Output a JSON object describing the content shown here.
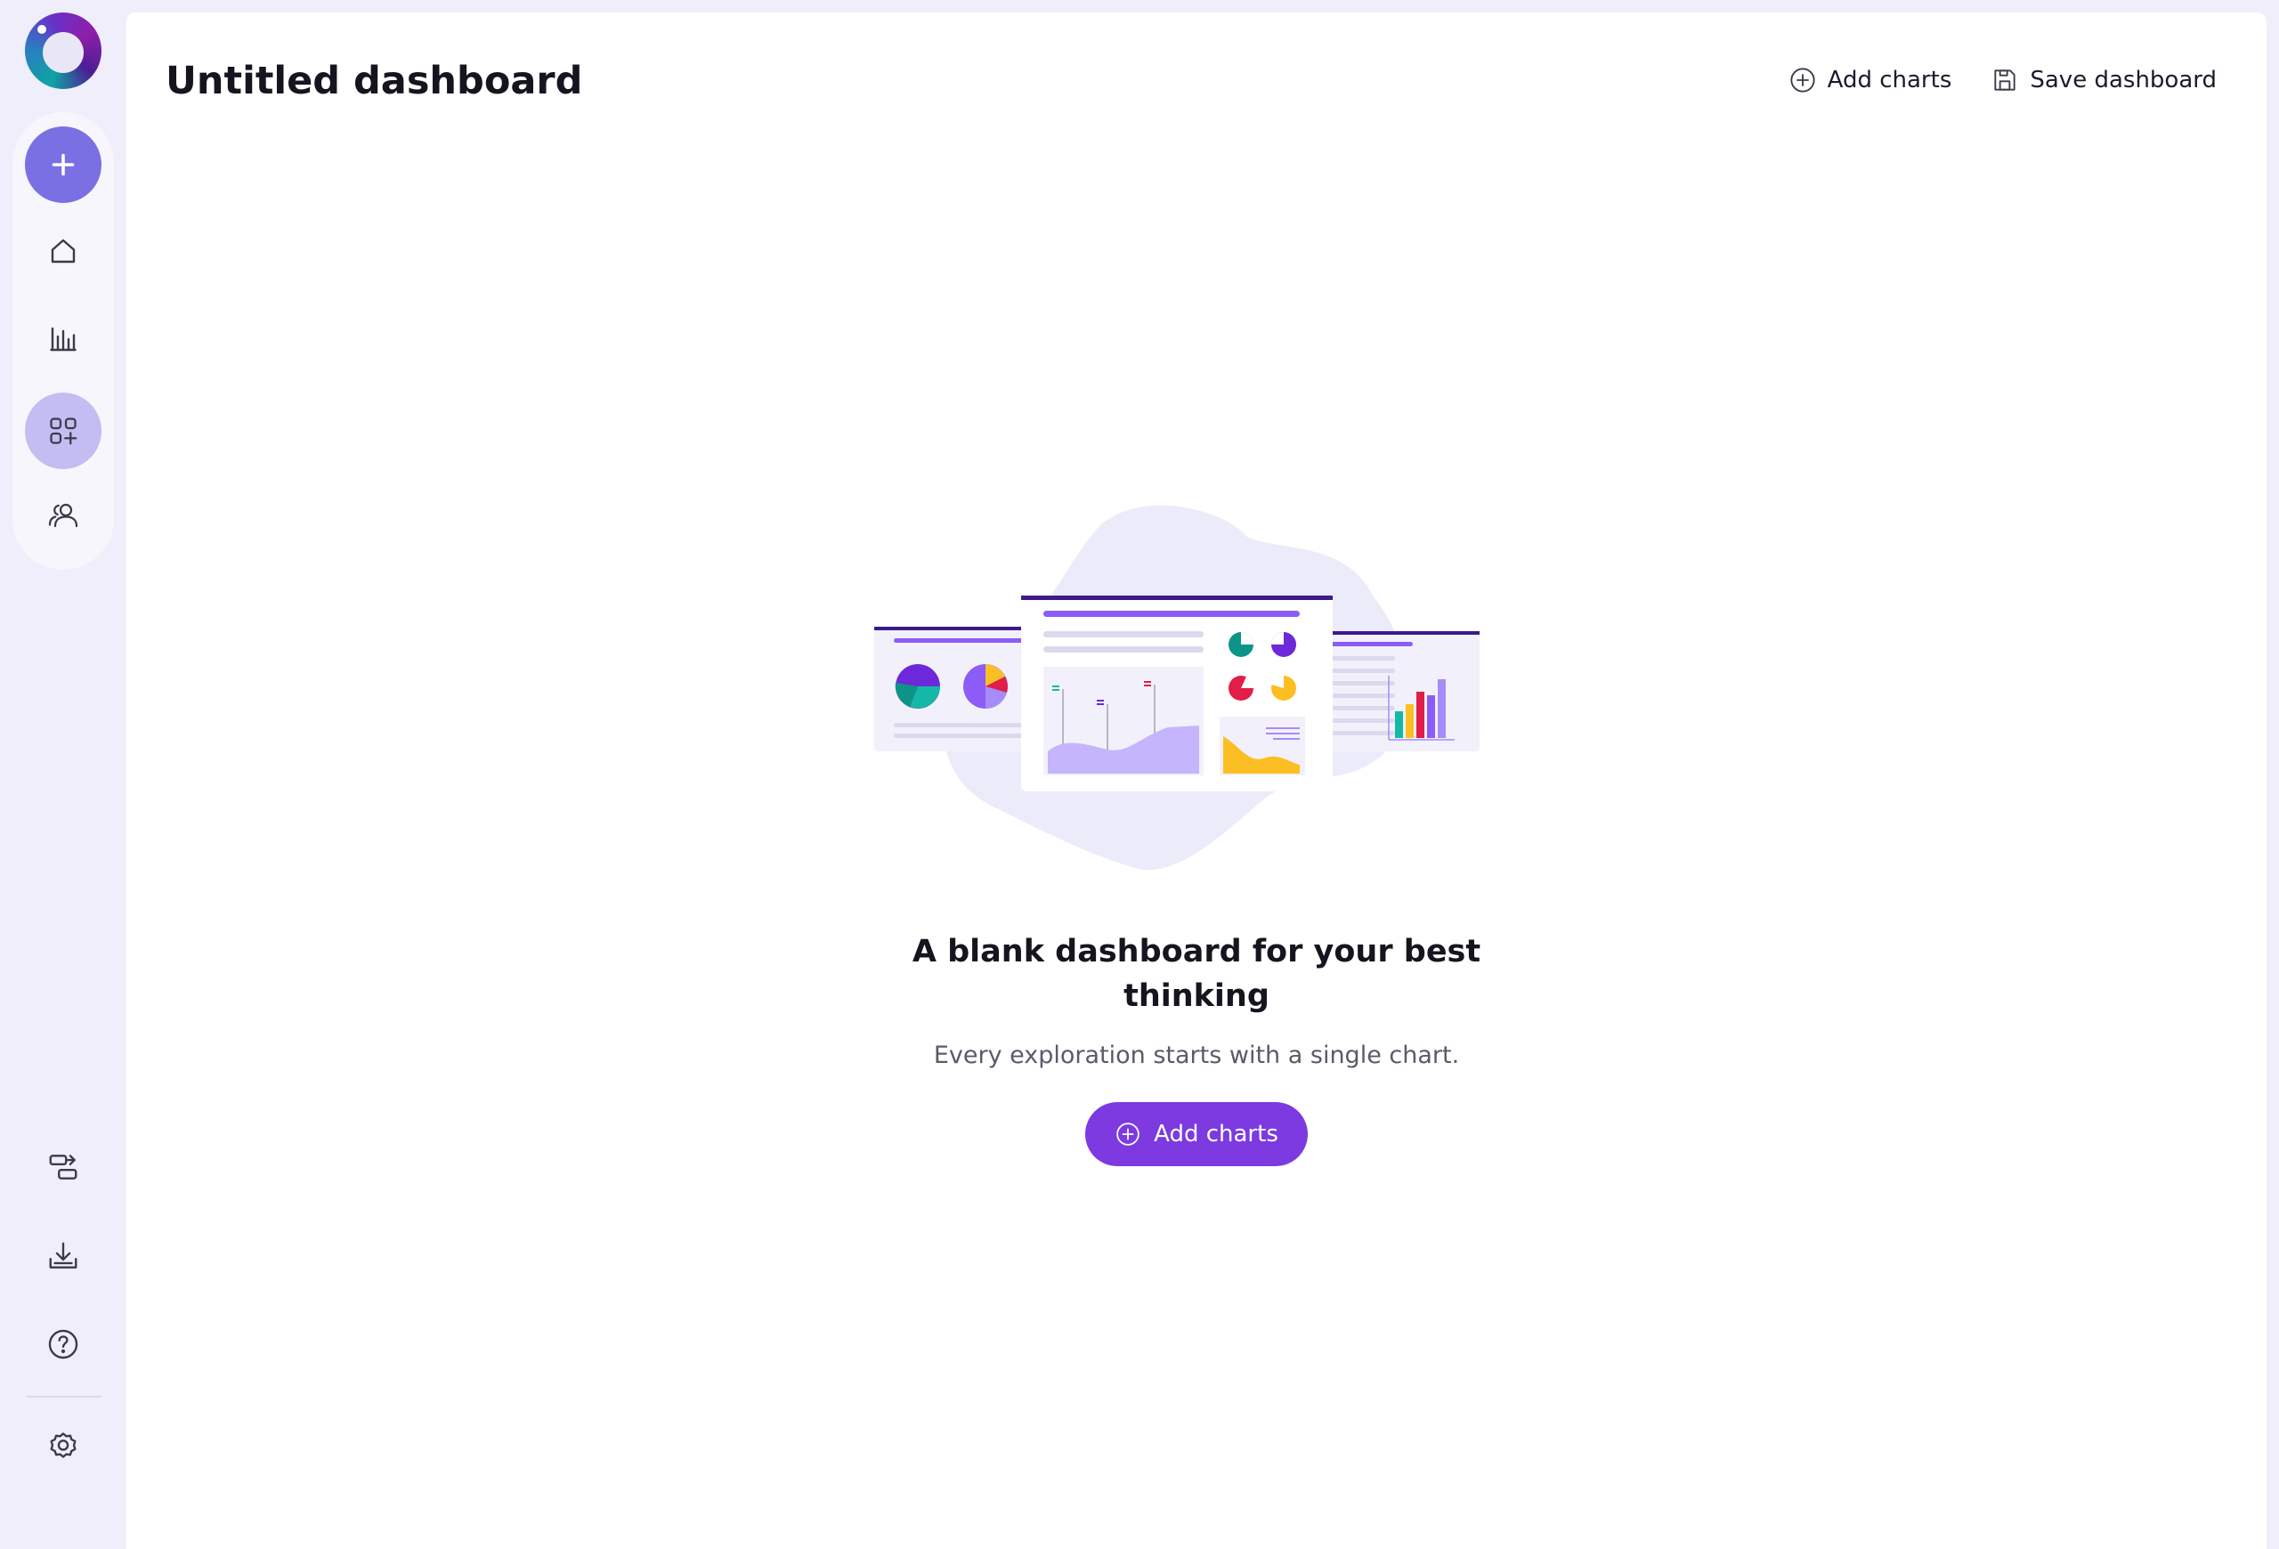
{
  "sidebar": {
    "top_items": [
      {
        "id": "create",
        "icon": "plus-icon"
      },
      {
        "id": "home",
        "icon": "home-icon"
      },
      {
        "id": "charts",
        "icon": "bar-chart-icon"
      },
      {
        "id": "dashboards",
        "icon": "dashboard-add-icon",
        "active": true
      },
      {
        "id": "users",
        "icon": "users-icon"
      }
    ],
    "bottom_items": [
      {
        "id": "switch",
        "icon": "switch-icon"
      },
      {
        "id": "download",
        "icon": "download-icon"
      },
      {
        "id": "help",
        "icon": "help-icon"
      },
      {
        "id": "settings",
        "icon": "gear-icon"
      }
    ]
  },
  "header": {
    "title": "Untitled dashboard",
    "add_charts_label": "Add charts",
    "save_label": "Save dashboard"
  },
  "empty_state": {
    "title_line1": "A blank dashboard for your best",
    "title_line2": "thinking",
    "subtitle": "Every exploration starts with a single chart.",
    "cta_label": "Add charts"
  },
  "colors": {
    "accent": "#7c3ae0",
    "sidebar_add": "#7b6fe4",
    "sidebar_active": "#c3bdf1",
    "background": "#efeefa"
  }
}
